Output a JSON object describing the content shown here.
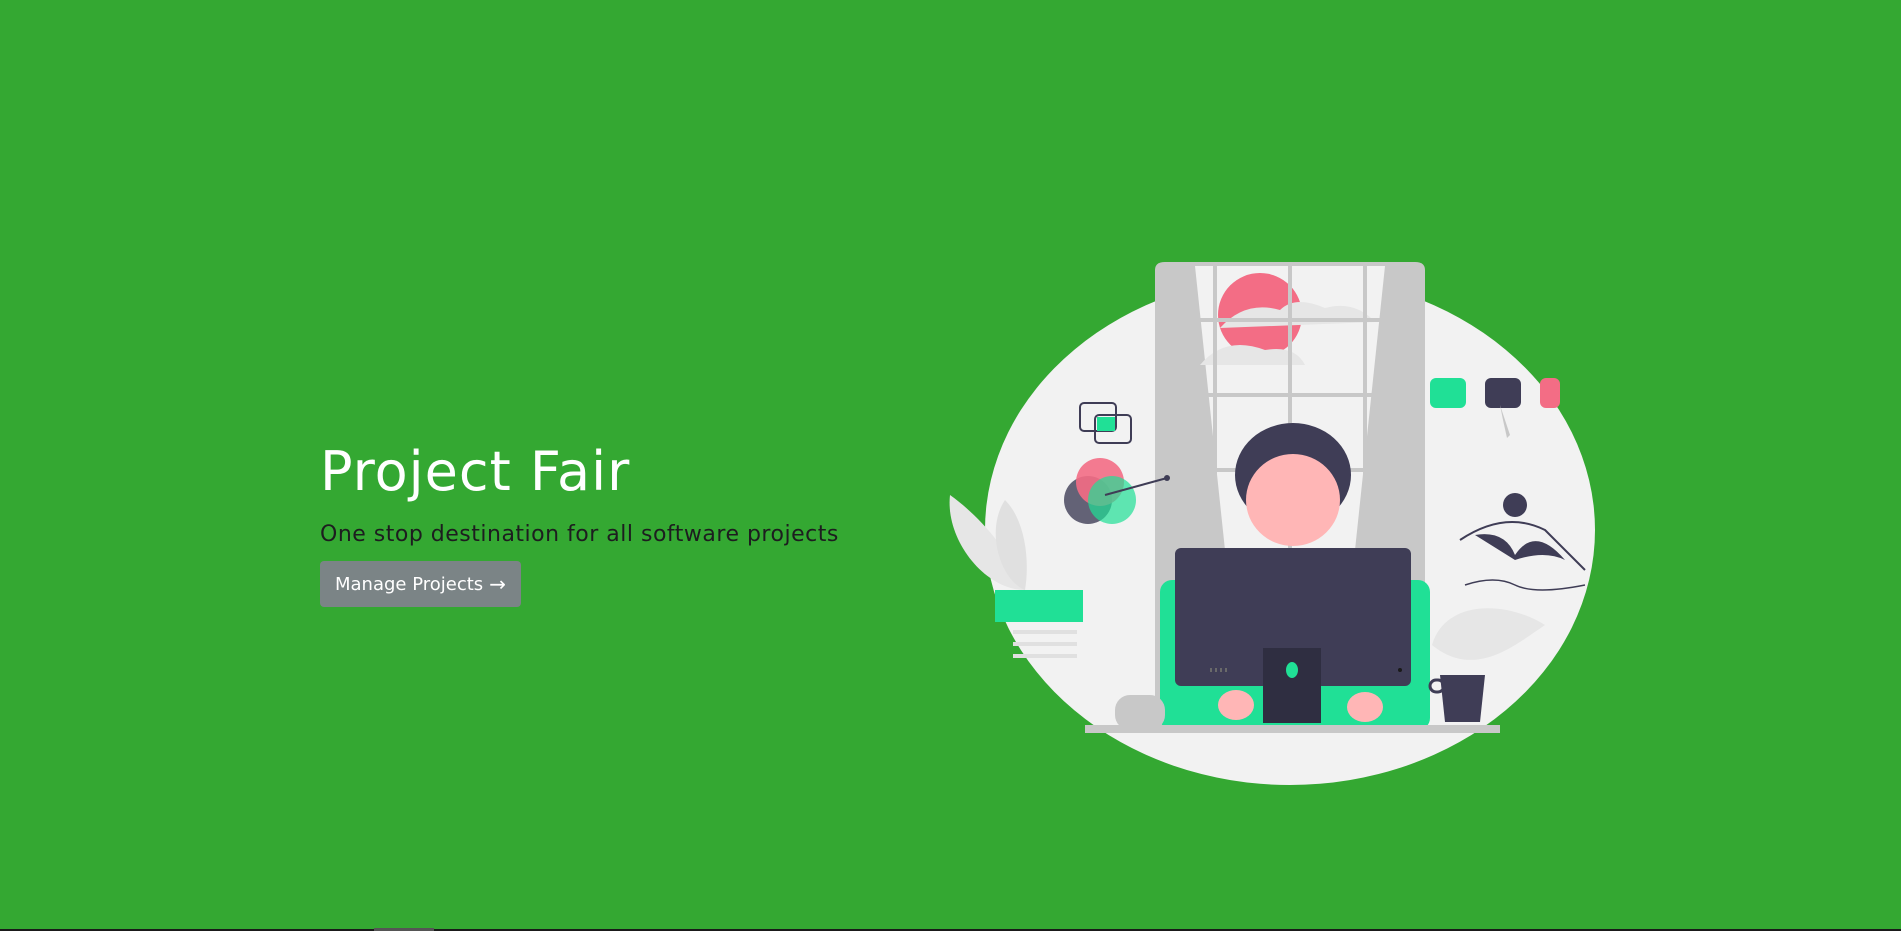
{
  "hero": {
    "title": "Project Fair",
    "subtitle": "One stop destination for all software projects",
    "button_label": "Manage Projects",
    "button_icon": "arrow-right-icon"
  },
  "colors": {
    "background": "#34a832",
    "title": "#ffffff",
    "subtitle": "#1d1d1f",
    "button_bg": "#7b8486",
    "illustration_circle": "#f2f2f2",
    "accent_green": "#20e096",
    "accent_pink": "#f36d85",
    "dark": "#3f3d56",
    "skin": "#ffb6b6"
  },
  "illustration": {
    "name": "person-at-computer-illustration"
  }
}
